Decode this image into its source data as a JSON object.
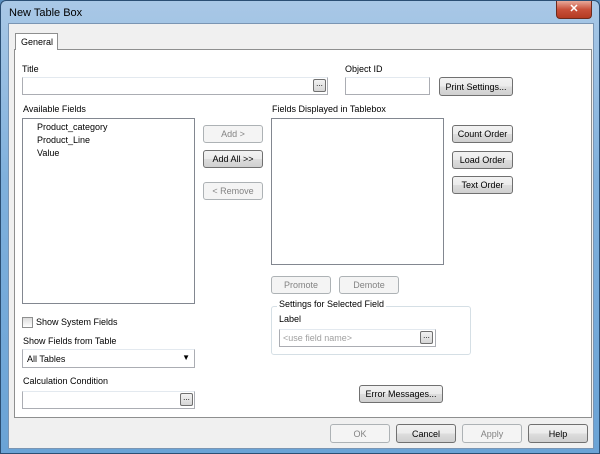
{
  "window": {
    "title": "New Table Box",
    "close_icon": "close-x-icon"
  },
  "tabs": [
    {
      "label": "General",
      "active": true
    }
  ],
  "title_field": {
    "label": "Title",
    "value": "",
    "browse": "..."
  },
  "object_id": {
    "label": "Object ID",
    "value": ""
  },
  "print_settings": "Print Settings...",
  "available_fields": {
    "label": "Available Fields",
    "items": [
      "Product_category",
      "Product_Line",
      "Value"
    ]
  },
  "move_buttons": {
    "add": "Add >",
    "add_all": "Add All >>",
    "remove": "< Remove"
  },
  "displayed_fields": {
    "label": "Fields Displayed in Tablebox",
    "items": []
  },
  "order_buttons": {
    "count": "Count Order",
    "load": "Load Order",
    "text": "Text Order"
  },
  "promote": "Promote",
  "demote": "Demote",
  "selected_field": {
    "group_label": "Settings for Selected Field",
    "label": "Label",
    "placeholder": "<use field name>",
    "browse": "..."
  },
  "show_system_fields": {
    "label": "Show System Fields",
    "checked": false
  },
  "show_fields_from_table": {
    "label": "Show Fields from Table",
    "selected": "All Tables"
  },
  "calculation_condition": {
    "label": "Calculation Condition",
    "value": "",
    "browse": "..."
  },
  "error_messages": "Error Messages...",
  "footer": {
    "ok": "OK",
    "cancel": "Cancel",
    "apply": "Apply",
    "help": "Help"
  }
}
